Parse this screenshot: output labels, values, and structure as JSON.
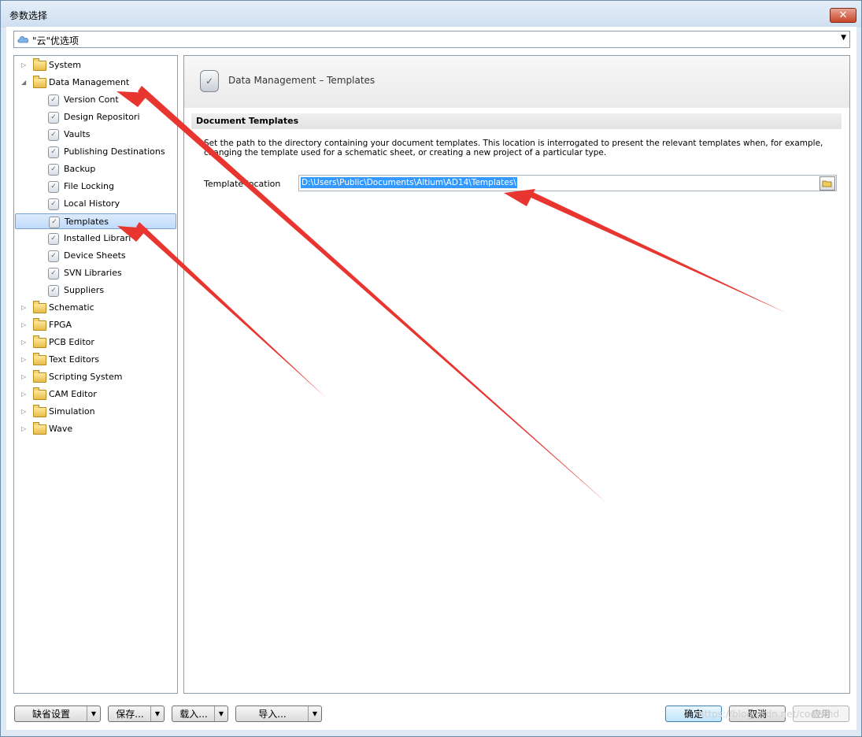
{
  "window": {
    "title": "参数选择",
    "close_label": "✕"
  },
  "scope": {
    "label": "\"云\"优选项"
  },
  "tree": [
    {
      "label": "System",
      "type": "folder",
      "expanded": false,
      "level": 0
    },
    {
      "label": "Data Management",
      "type": "folder",
      "expanded": true,
      "level": 0
    },
    {
      "label": "Version Cont",
      "type": "page",
      "level": 1
    },
    {
      "label": "Design Repositori",
      "type": "page",
      "level": 1
    },
    {
      "label": "Vaults",
      "type": "page",
      "level": 1
    },
    {
      "label": "Publishing Destinations",
      "type": "page",
      "level": 1
    },
    {
      "label": "Backup",
      "type": "page",
      "level": 1
    },
    {
      "label": "File Locking",
      "type": "page",
      "level": 1
    },
    {
      "label": "Local History",
      "type": "page",
      "level": 1
    },
    {
      "label": "Templates",
      "type": "page",
      "level": 1,
      "selected": true
    },
    {
      "label": "Installed Librari",
      "type": "page",
      "level": 1
    },
    {
      "label": "Device Sheets",
      "type": "page",
      "level": 1
    },
    {
      "label": "SVN Libraries",
      "type": "page",
      "level": 1
    },
    {
      "label": "Suppliers",
      "type": "page",
      "level": 1
    },
    {
      "label": "Schematic",
      "type": "folder",
      "expanded": false,
      "level": 0
    },
    {
      "label": "FPGA",
      "type": "folder",
      "expanded": false,
      "level": 0
    },
    {
      "label": "PCB Editor",
      "type": "folder",
      "expanded": false,
      "level": 0
    },
    {
      "label": "Text Editors",
      "type": "folder",
      "expanded": false,
      "level": 0
    },
    {
      "label": "Scripting System",
      "type": "folder",
      "expanded": false,
      "level": 0
    },
    {
      "label": "CAM Editor",
      "type": "folder",
      "expanded": false,
      "level": 0
    },
    {
      "label": "Simulation",
      "type": "folder",
      "expanded": false,
      "level": 0
    },
    {
      "label": "Wave",
      "type": "folder",
      "expanded": false,
      "level": 0
    }
  ],
  "panel": {
    "title": "Data Management – Templates",
    "section": "Document Templates",
    "description_line1": "Set the path to the directory containing your document templates. This location is interrogated to present the relevant templates when, for example,",
    "description_line2": "changing the template used for a schematic sheet, or creating a new project of a particular type.",
    "template_location_label": "Template location",
    "template_location_value": "D:\\Users\\Public\\Documents\\Altium\\AD14\\Templates\\"
  },
  "buttons": {
    "defaults": "缺省设置",
    "save": "保存...",
    "load": "载入...",
    "import": "导入...",
    "ok": "确定",
    "cancel": "取消",
    "apply": "应用"
  },
  "watermark": "https://blog.csdn.net/codechd",
  "colors": {
    "selection": "#3399ff",
    "annotation_arrow": "#e8352f"
  }
}
